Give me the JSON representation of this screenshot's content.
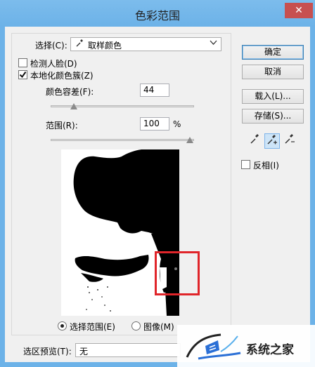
{
  "window": {
    "title": "色彩范围",
    "close_glyph": "✕"
  },
  "select": {
    "label": "选择(C):",
    "value": "取样颜色",
    "icon": "eyedropper-icon",
    "arrow": "⌵"
  },
  "options": {
    "detect_faces": "检测人脸(D)",
    "localized_clusters": "本地化颜色簇(Z)",
    "detect_faces_checked": false,
    "localized_clusters_checked": true
  },
  "fuzziness": {
    "label": "颜色容差(F):",
    "value": "44",
    "slider_level": 0.16
  },
  "range": {
    "label": "范围(R):",
    "value": "100",
    "unit": "%",
    "slider_level": 1.0
  },
  "preview_mode": {
    "selection": "选择范围(E)",
    "image": "图像(M)",
    "selected": "selection"
  },
  "buttons": {
    "ok": "确定",
    "cancel": "取消",
    "load": "载入(L)...",
    "save": "存储(S)..."
  },
  "tools": {
    "sample": "eyedropper-icon",
    "add": "eyedropper-plus-icon",
    "subtract": "eyedropper-minus-icon",
    "active": "add"
  },
  "invert": {
    "label": "反相(I)",
    "checked": false
  },
  "selection_preview": {
    "label": "选区预览(T):",
    "value": "无"
  },
  "watermark": {
    "text": "系统之家"
  },
  "colors": {
    "titlebar": "#6cb2e8",
    "close": "#c75050",
    "highlight": "#e0252a"
  }
}
